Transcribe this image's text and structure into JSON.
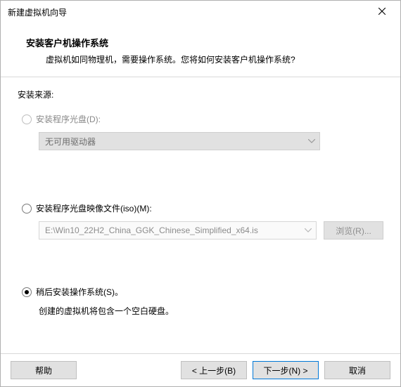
{
  "titlebar": {
    "title": "新建虚拟机向导"
  },
  "header": {
    "heading": "安装客户机操作系统",
    "subheading": "虚拟机如同物理机，需要操作系统。您将如何安装客户机操作系统?"
  },
  "content": {
    "source_label": "安装来源:",
    "opt_disc": {
      "label": "安装程序光盘(D):",
      "dropdown_text": "无可用驱动器"
    },
    "opt_iso": {
      "label": "安装程序光盘映像文件(iso)(M):",
      "path": "E:\\Win10_22H2_China_GGK_Chinese_Simplified_x64.is",
      "browse": "浏览(R)..."
    },
    "opt_later": {
      "label": "稍后安装操作系统(S)。",
      "desc": "创建的虚拟机将包含一个空白硬盘。"
    }
  },
  "footer": {
    "help": "帮助",
    "back": "< 上一步(B)",
    "next": "下一步(N) >",
    "cancel": "取消"
  }
}
